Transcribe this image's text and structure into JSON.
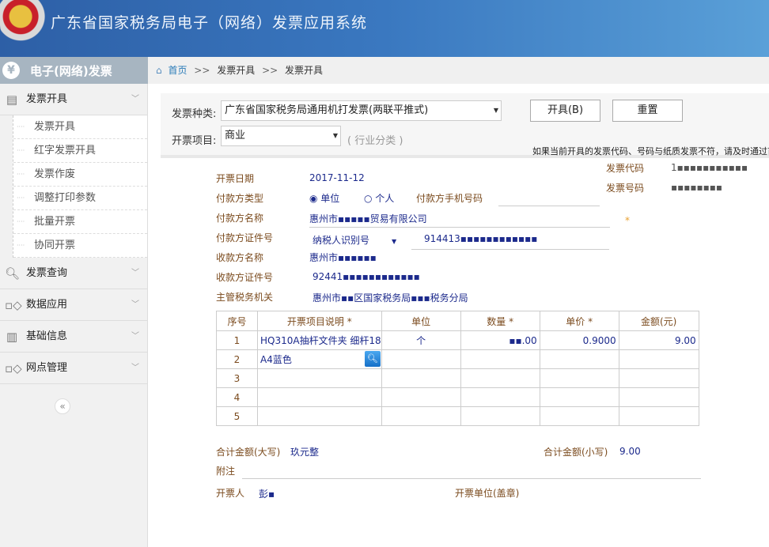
{
  "header": {
    "title": "广东省国家税务局电子（网络）发票应用系统"
  },
  "sidebar": {
    "title": "电子(网络)发票",
    "yen_icon": "¥",
    "groups": [
      {
        "label": "发票开具",
        "icon": "document-icon",
        "expanded": true,
        "items": [
          "发票开具",
          "红字发票开具",
          "发票作废",
          "调整打印参数",
          "批量开票",
          "协同开票"
        ]
      },
      {
        "label": "发票查询",
        "icon": "search-icon"
      },
      {
        "label": "数据应用",
        "icon": "grid-icon"
      },
      {
        "label": "基础信息",
        "icon": "bar-chart-icon"
      },
      {
        "label": "网点管理",
        "icon": "grid-icon"
      }
    ],
    "collapse": "«"
  },
  "breadcrumb": {
    "home": "首页",
    "sep": ">>",
    "items": [
      "发票开具",
      "发票开具"
    ]
  },
  "toolbar": {
    "invoice_type_label": "发票种类:",
    "invoice_type_value": "广东省国家税务局通用机打发票(两联平推式)",
    "item_label": "开票项目:",
    "item_value": "商业",
    "item_hint": "( 行业分类 )",
    "issue_button": "开具(B)",
    "reset_button": "重置",
    "notice": "如果当前开具的发票代码、号码与纸质发票不符，请及时通过首"
  },
  "form": {
    "date_label": "开票日期",
    "date_value": "2017-11-12",
    "code_label": "发票代码",
    "code_value": "1▪▪▪▪▪▪▪▪▪▪▪",
    "number_label": "发票号码",
    "number_value": "▪▪▪▪▪▪▪▪",
    "payer_type_label": "付款方类型",
    "payer_type_options": [
      "单位",
      "个人"
    ],
    "payer_type_selected": "单位",
    "payer_phone_label": "付款方手机号码",
    "payer_phone_value": "",
    "payer_name_label": "付款方名称",
    "payer_name_value": "惠州市▪▪▪▪▪贸易有限公司",
    "payer_id_label": "付款方证件号",
    "payer_id_type": "纳税人识别号",
    "payer_id_value": "914413▪▪▪▪▪▪▪▪▪▪▪▪",
    "payee_name_label": "收款方名称",
    "payee_name_value": "惠州市▪▪▪▪▪▪",
    "payee_id_label": "收款方证件号",
    "payee_id_value": "92441▪▪▪▪▪▪▪▪▪▪▪▪",
    "tax_office_label": "主管税务机关",
    "tax_office_value": "惠州市▪▪区国家税务局▪▪▪税务分局",
    "required_mark": "*"
  },
  "table": {
    "headers": [
      "序号",
      "开票项目说明 *",
      "单位",
      "数量  *",
      "单价  *",
      "金额(元)"
    ],
    "rows": [
      [
        "1",
        "HQ310A抽杆文件夹 细杆18",
        "个",
        "▪▪.00",
        "0.9000",
        "9.00"
      ],
      [
        "2",
        "A4蓝色",
        "",
        "",
        "",
        ""
      ],
      [
        "3",
        "",
        "",
        "",
        "",
        ""
      ],
      [
        "4",
        "",
        "",
        "",
        "",
        ""
      ],
      [
        "5",
        "",
        "",
        "",
        "",
        ""
      ]
    ]
  },
  "totals": {
    "upper_label": "合计金额(大写)",
    "upper_value": "玖元整",
    "lower_label": "合计金额(小写)",
    "lower_value": "9.00",
    "remark_label": "附注",
    "drawer_label": "开票人",
    "drawer_value": "彭▪",
    "seal_label": "开票单位(盖章)"
  }
}
